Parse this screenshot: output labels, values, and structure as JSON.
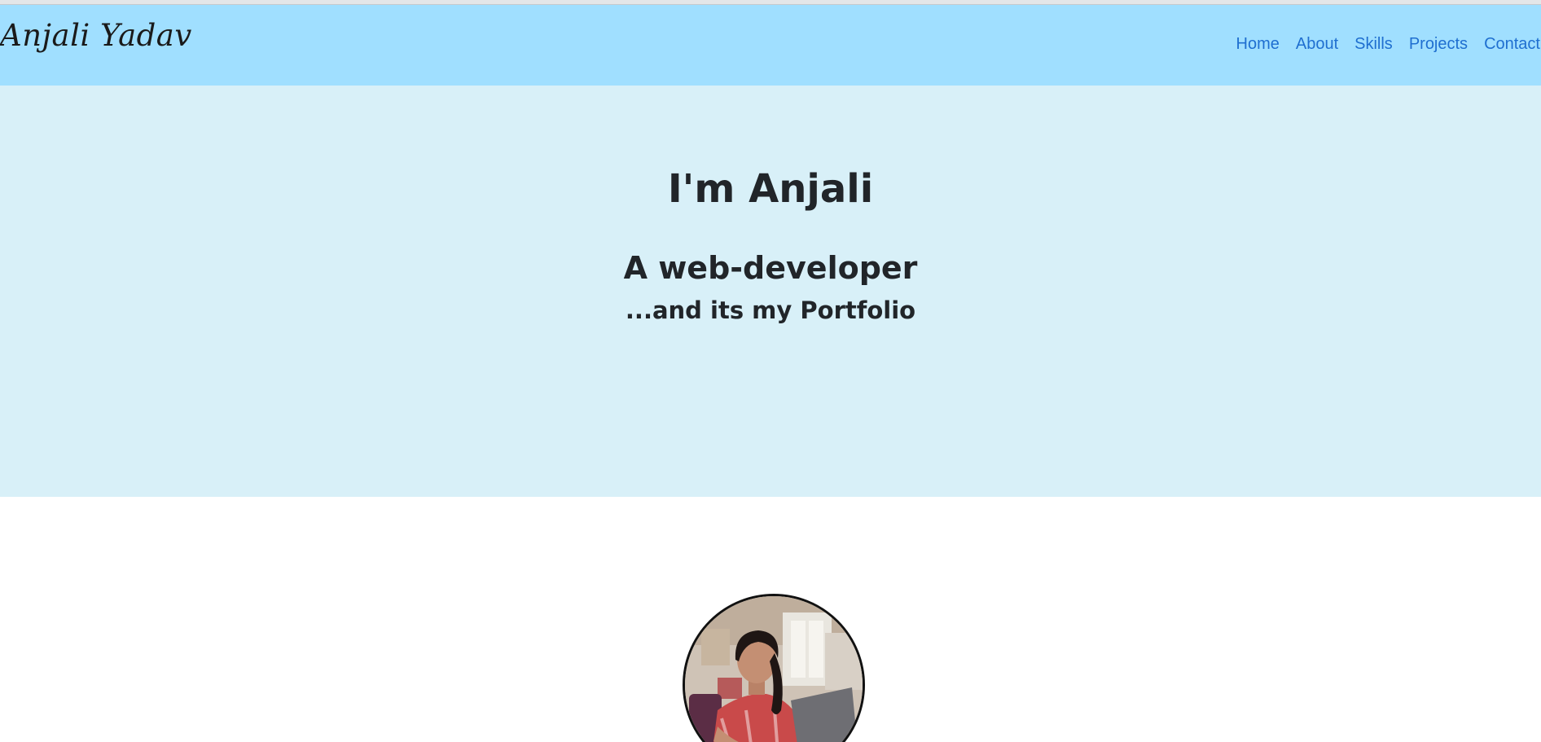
{
  "navbar": {
    "brand": "Anjali Yadav",
    "links": [
      "Home",
      "About",
      "Skills",
      "Projects",
      "Contact"
    ]
  },
  "hero": {
    "title": "I'm Anjali",
    "subtitle": "A web-developer",
    "tagline": "...and its my Portfolio"
  },
  "colors": {
    "navbar_bg": "#a0dfff",
    "hero_bg": "#d8f0f8",
    "link": "#1f6fd0",
    "text": "#212529"
  },
  "profile": {
    "photo": "portrait of a woman working on a laptop"
  }
}
